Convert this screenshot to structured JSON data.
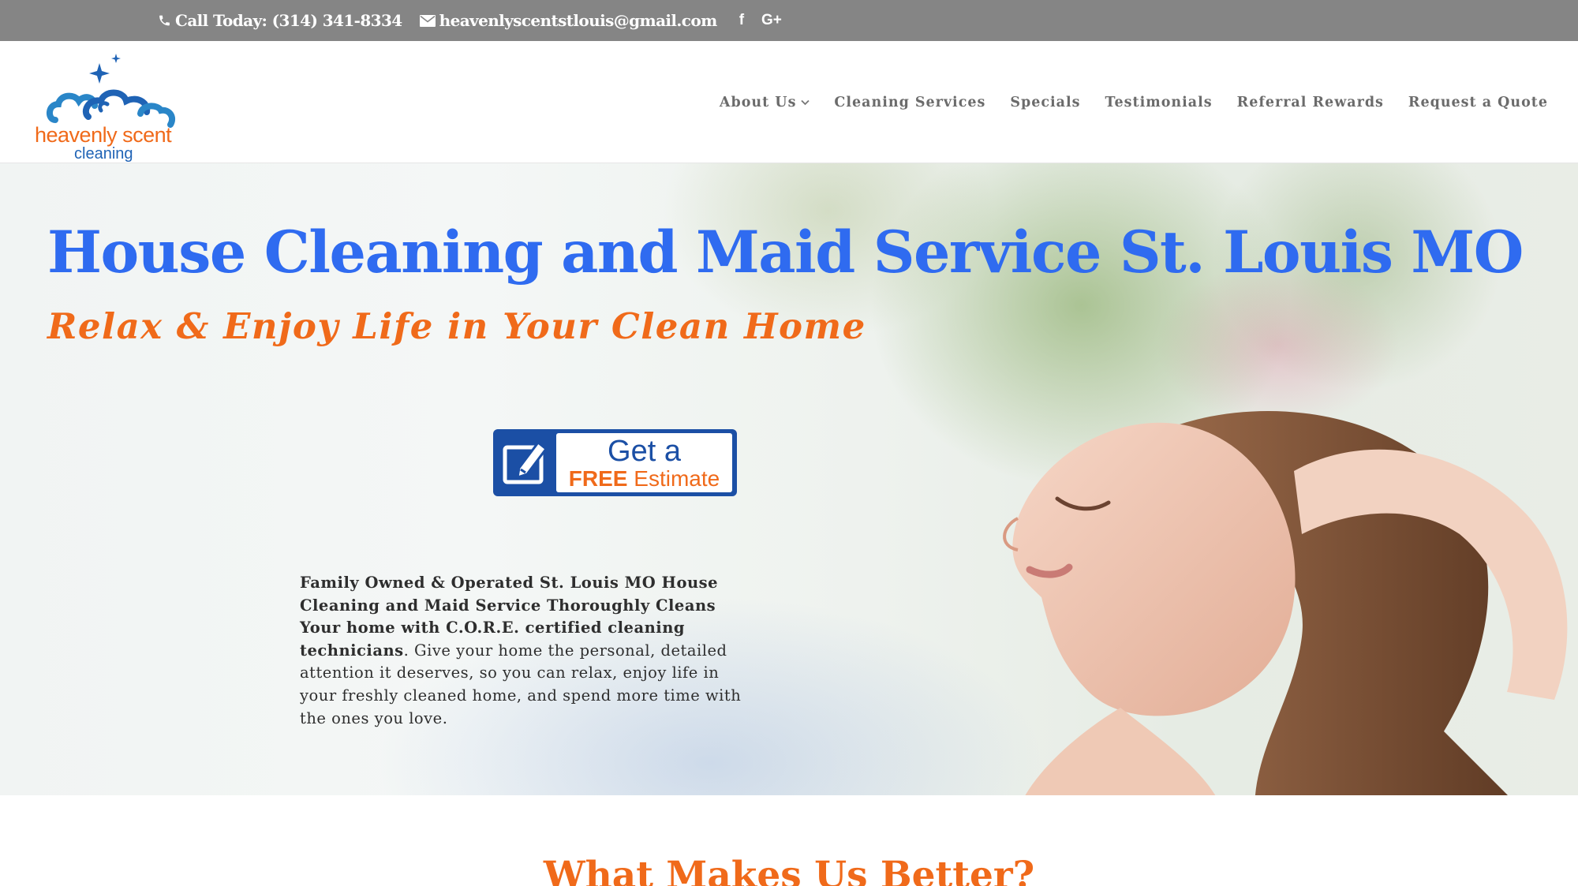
{
  "topbar": {
    "phone": "Call Today: (314) 341-8334",
    "email": "heavenlyscentstlouis@gmail.com",
    "social": [
      "f",
      "G+"
    ]
  },
  "logo": {
    "line1": "heavenly scent",
    "line2": "cleaning"
  },
  "nav": {
    "items": [
      {
        "label": "About Us",
        "has_dropdown": true
      },
      {
        "label": "Cleaning Services"
      },
      {
        "label": "Specials"
      },
      {
        "label": "Testimonials"
      },
      {
        "label": "Referral Rewards"
      },
      {
        "label": "Request a Quote"
      }
    ]
  },
  "hero": {
    "title": "House Cleaning and Maid Service St. Louis MO",
    "subtitle": "Relax & Enjoy Life in Your Clean Home",
    "estimate": {
      "line1": "Get a",
      "line2_bold": "FREE",
      "line2_rest": " Estimate"
    },
    "intro_bold": "Family Owned & Operated St. Louis MO House Cleaning and Maid Service Thoroughly Cleans Your home with C.O.R.E. certified cleaning technicians",
    "intro_rest": ". Give your home the personal, detailed attention it deserves, so you can relax, enjoy life in your freshly cleaned home, and spend more time with the ones you love."
  },
  "section": {
    "heading": "What Makes Us Better?"
  },
  "colors": {
    "topbar": "#858585",
    "title_blue": "#2f6bf0",
    "accent_orange": "#f06a1a",
    "brand_blue": "#1b4fa5"
  }
}
